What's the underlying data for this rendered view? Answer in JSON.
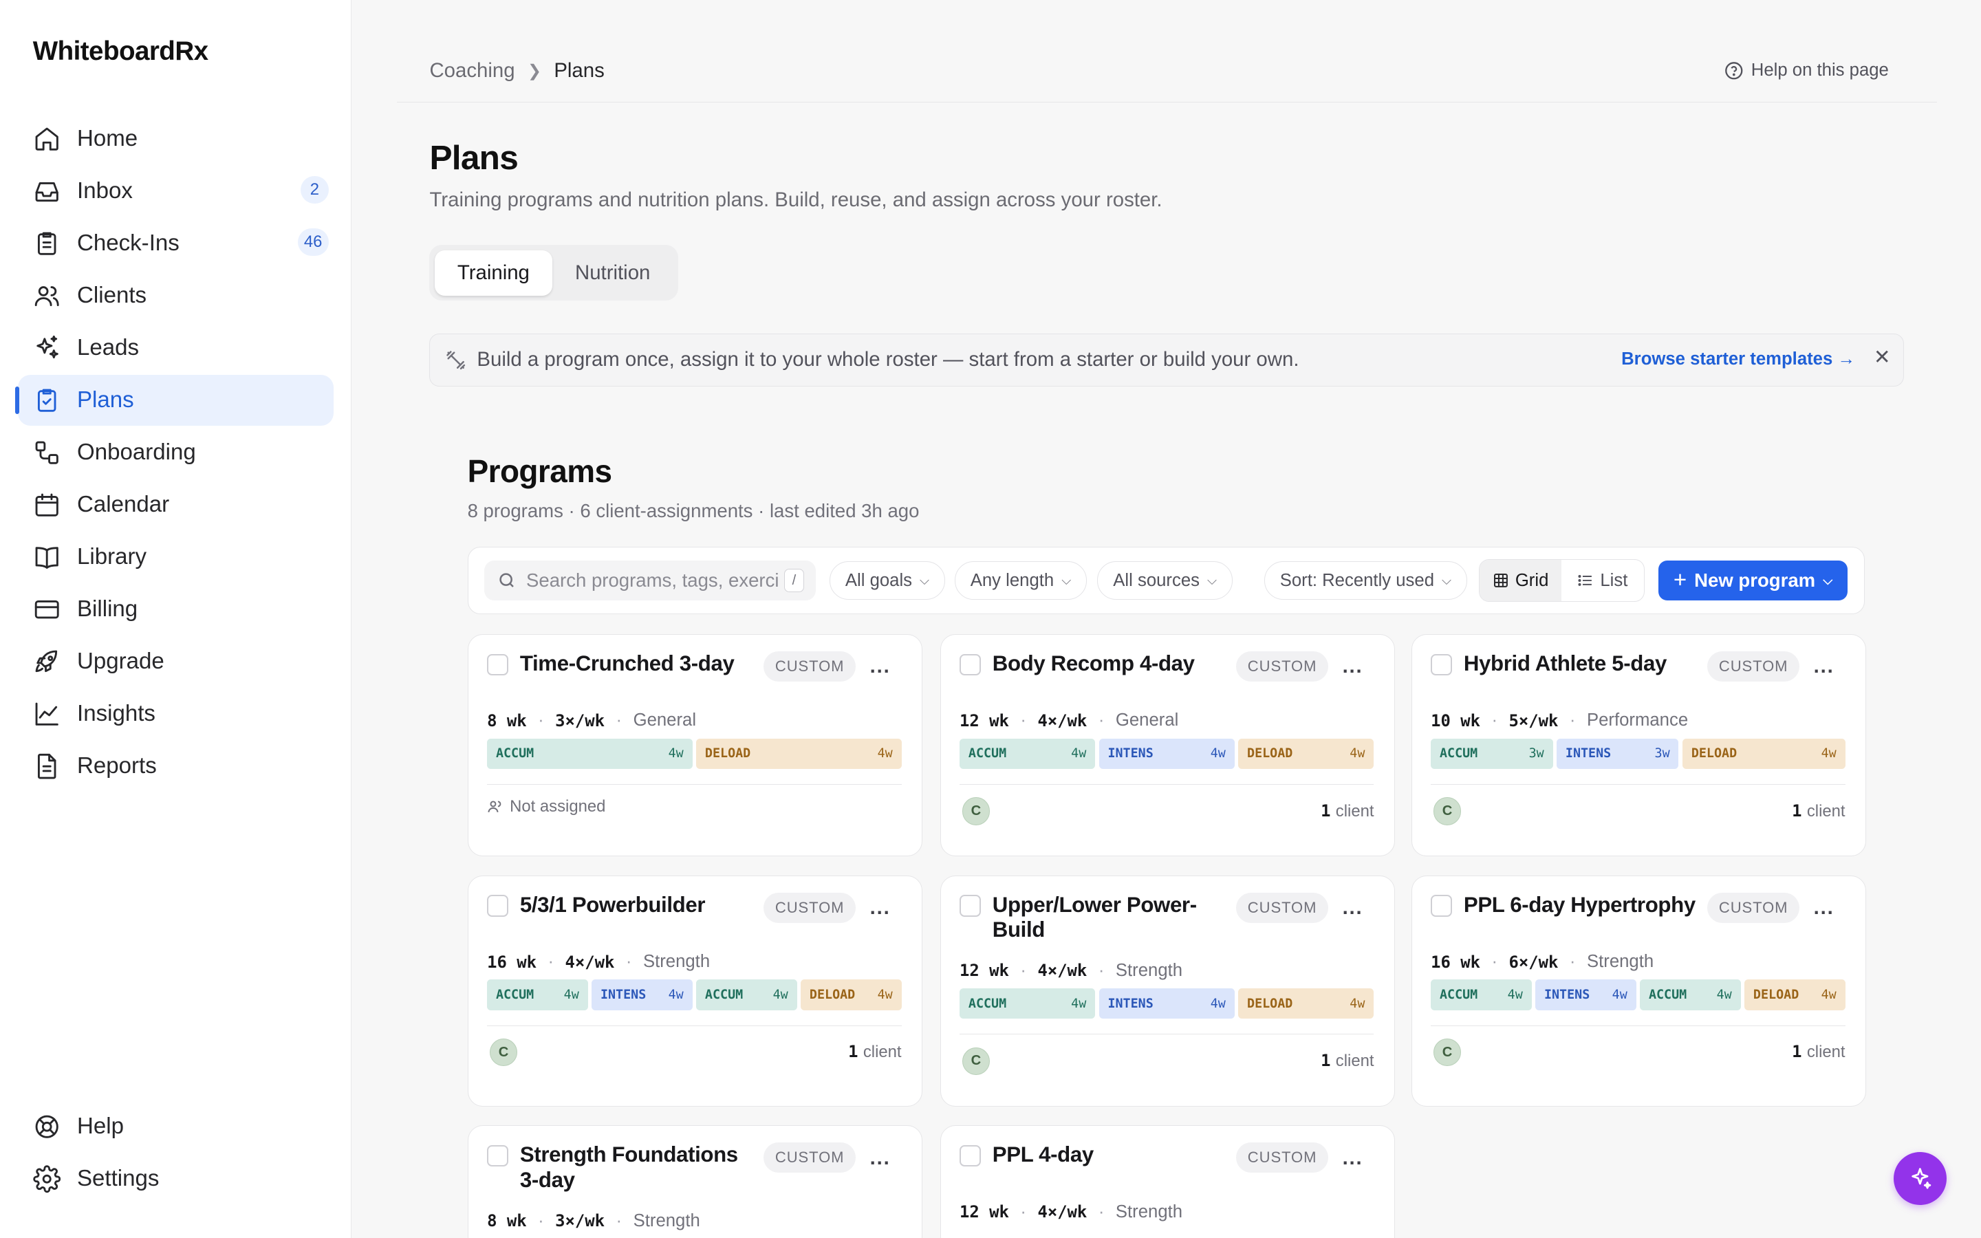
{
  "app": {
    "name": "WhiteboardRx"
  },
  "nav": {
    "items": [
      {
        "label": "Home",
        "icon": "home-icon"
      },
      {
        "label": "Inbox",
        "icon": "inbox-icon",
        "badge": "2"
      },
      {
        "label": "Check-Ins",
        "icon": "clipboard-icon",
        "badge": "46"
      },
      {
        "label": "Clients",
        "icon": "users-icon"
      },
      {
        "label": "Leads",
        "icon": "sparkles-icon"
      },
      {
        "label": "Plans",
        "icon": "clipboard-check-icon",
        "active": true
      },
      {
        "label": "Onboarding",
        "icon": "flow-icon"
      },
      {
        "label": "Calendar",
        "icon": "calendar-icon"
      },
      {
        "label": "Library",
        "icon": "book-icon"
      },
      {
        "label": "Billing",
        "icon": "credit-card-icon"
      },
      {
        "label": "Upgrade",
        "icon": "rocket-icon"
      },
      {
        "label": "Insights",
        "icon": "chart-line-icon"
      },
      {
        "label": "Reports",
        "icon": "document-icon"
      }
    ],
    "bottom": [
      {
        "label": "Help",
        "icon": "lifebuoy-icon"
      },
      {
        "label": "Settings",
        "icon": "gear-icon"
      }
    ]
  },
  "breadcrumb": {
    "parent": "Coaching",
    "current": "Plans"
  },
  "help_link": "Help on this page",
  "page": {
    "title": "Plans",
    "subtitle": "Training programs and nutrition plans. Build, reuse, and assign across your roster."
  },
  "tabs": [
    "Training",
    "Nutrition"
  ],
  "banner": {
    "text": "Build a program once, assign it to your whole roster — start from a starter or build your own.",
    "link": "Browse starter templates →",
    "close": "✕"
  },
  "programs": {
    "title": "Programs",
    "summary": "8 programs · 6 client-assignments · last edited 3h ago"
  },
  "toolbar": {
    "search_placeholder": "Search programs, tags, exercises",
    "search_shortcut": "/",
    "filters": [
      "All goals",
      "Any length",
      "All sources"
    ],
    "sort": "Sort: Recently used",
    "view_grid": "Grid",
    "view_list": "List",
    "new_program": "New program"
  },
  "cards": [
    {
      "title": "Time-Crunched 3-day",
      "tag": "CUSTOM",
      "weeks": "8 wk",
      "freq": "3×/wk",
      "goal": "General",
      "phases": [
        {
          "name": "ACCUM",
          "weeks": "4w",
          "kind": "accum"
        },
        {
          "name": "DELOAD",
          "weeks": "4w",
          "kind": "deload"
        }
      ],
      "assigned": false,
      "unassigned_label": "Not assigned"
    },
    {
      "title": "Body Recomp 4-day",
      "tag": "CUSTOM",
      "weeks": "12 wk",
      "freq": "4×/wk",
      "goal": "General",
      "phases": [
        {
          "name": "ACCUM",
          "weeks": "4w",
          "kind": "accum"
        },
        {
          "name": "INTENS",
          "weeks": "4w",
          "kind": "intens"
        },
        {
          "name": "DELOAD",
          "weeks": "4w",
          "kind": "deload"
        }
      ],
      "assigned": true,
      "avatar": "C",
      "clients_count": "1",
      "clients_label": "client"
    },
    {
      "title": "Hybrid Athlete 5-day",
      "tag": "CUSTOM",
      "weeks": "10 wk",
      "freq": "5×/wk",
      "goal": "Performance",
      "phases": [
        {
          "name": "ACCUM",
          "weeks": "3w",
          "kind": "accum"
        },
        {
          "name": "INTENS",
          "weeks": "3w",
          "kind": "intens"
        },
        {
          "name": "DELOAD",
          "weeks": "4w",
          "kind": "deload"
        }
      ],
      "assigned": true,
      "avatar": "C",
      "clients_count": "1",
      "clients_label": "client"
    },
    {
      "title": "5/3/1 Powerbuilder",
      "tag": "CUSTOM",
      "weeks": "16 wk",
      "freq": "4×/wk",
      "goal": "Strength",
      "phases": [
        {
          "name": "ACCUM",
          "weeks": "4w",
          "kind": "accum"
        },
        {
          "name": "INTENS",
          "weeks": "4w",
          "kind": "intens"
        },
        {
          "name": "ACCUM",
          "weeks": "4w",
          "kind": "accum"
        },
        {
          "name": "DELOAD",
          "weeks": "4w",
          "kind": "deload"
        }
      ],
      "assigned": true,
      "avatar": "C",
      "clients_count": "1",
      "clients_label": "client"
    },
    {
      "title": "Upper/Lower Power-Build",
      "tag": "CUSTOM",
      "weeks": "12 wk",
      "freq": "4×/wk",
      "goal": "Strength",
      "phases": [
        {
          "name": "ACCUM",
          "weeks": "4w",
          "kind": "accum"
        },
        {
          "name": "INTENS",
          "weeks": "4w",
          "kind": "intens"
        },
        {
          "name": "DELOAD",
          "weeks": "4w",
          "kind": "deload"
        }
      ],
      "assigned": true,
      "avatar": "C",
      "clients_count": "1",
      "clients_label": "client"
    },
    {
      "title": "PPL 6-day Hypertrophy",
      "tag": "CUSTOM",
      "weeks": "16 wk",
      "freq": "6×/wk",
      "goal": "Strength",
      "phases": [
        {
          "name": "ACCUM",
          "weeks": "4w",
          "kind": "accum"
        },
        {
          "name": "INTENS",
          "weeks": "4w",
          "kind": "intens"
        },
        {
          "name": "ACCUM",
          "weeks": "4w",
          "kind": "accum"
        },
        {
          "name": "DELOAD",
          "weeks": "4w",
          "kind": "deload"
        }
      ],
      "assigned": true,
      "avatar": "C",
      "clients_count": "1",
      "clients_label": "client"
    },
    {
      "title": "Strength Foundations 3-day",
      "tag": "CUSTOM",
      "weeks": "8 wk",
      "freq": "3×/wk",
      "goal": "Strength",
      "phases": [],
      "assigned": null
    },
    {
      "title": "PPL 4-day",
      "tag": "CUSTOM",
      "weeks": "12 wk",
      "freq": "4×/wk",
      "goal": "Strength",
      "phases": [],
      "assigned": null
    }
  ],
  "fab": {
    "icon": "sparkles-icon"
  },
  "colors": {
    "accent": "#2563eb",
    "active_nav_bg": "#eaf1fe",
    "fab": "#9333ea",
    "accum": "#d6ebe6",
    "intens": "#dbe5fb",
    "deload": "#f6e6cf"
  }
}
